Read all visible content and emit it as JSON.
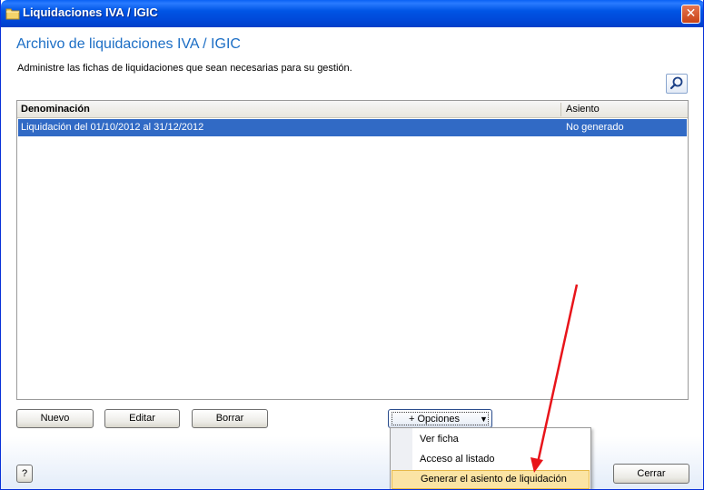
{
  "window": {
    "title": "Liquidaciones IVA / IGIC",
    "close_glyph": "✕"
  },
  "page": {
    "heading": "Archivo de liquidaciones IVA / IGIC",
    "description": "Administre las fichas de liquidaciones que sean necesarias para su gestión.",
    "search_icon": "search-icon"
  },
  "grid": {
    "columns": [
      "Denominación",
      "Asiento"
    ],
    "rows": [
      {
        "denominacion": "Liquidación del 01/10/2012 al 31/12/2012",
        "asiento": "No generado",
        "selected": true
      }
    ]
  },
  "buttons": {
    "nuevo": "Nuevo",
    "editar": "Editar",
    "borrar": "Borrar",
    "opciones": "+ Opciones",
    "help": "?",
    "cerrar": "Cerrar"
  },
  "options_menu": {
    "items": [
      "Ver ficha",
      "Acceso al listado",
      "Generar el asiento de liquidación"
    ],
    "highlighted_index": 2
  },
  "colors": {
    "title_blue": "#1c6ec5",
    "selection": "#316ac5",
    "menu_highlight": "#fbe4a4",
    "annotation_arrow": "#e8141a"
  }
}
